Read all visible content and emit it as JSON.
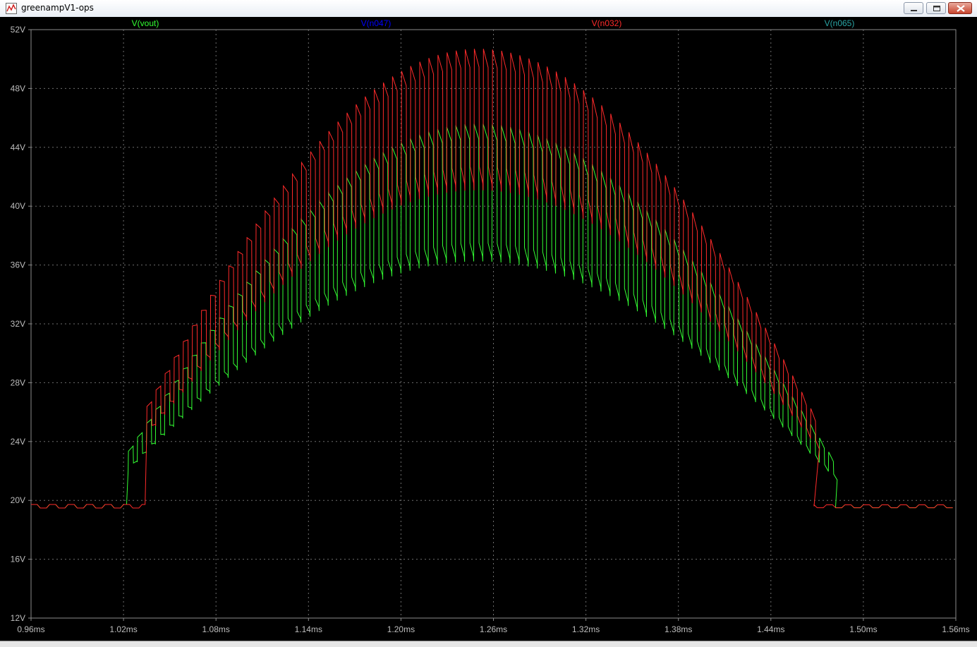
{
  "window": {
    "title": "greenampV1-ops"
  },
  "icons": {
    "app": "waveform-icon",
    "minimize": "minimize-icon",
    "maximize": "maximize-icon",
    "close": "close-icon"
  },
  "chart_data": {
    "type": "line",
    "background": "#000000",
    "grid": true,
    "x_unit": "ms",
    "y_unit": "V",
    "xlim": [
      0.96,
      1.56
    ],
    "ylim": [
      12,
      52
    ],
    "x_ticks": [
      0.96,
      1.02,
      1.08,
      1.14,
      1.2,
      1.26,
      1.32,
      1.38,
      1.44,
      1.5,
      1.56
    ],
    "x_tick_labels": [
      "0.96ms",
      "1.02ms",
      "1.08ms",
      "1.14ms",
      "1.20ms",
      "1.26ms",
      "1.32ms",
      "1.38ms",
      "1.44ms",
      "1.50ms",
      "1.56ms"
    ],
    "y_ticks": [
      12,
      16,
      20,
      24,
      28,
      32,
      36,
      40,
      44,
      48,
      52
    ],
    "y_tick_labels": [
      "12V",
      "16V",
      "20V",
      "24V",
      "28V",
      "32V",
      "36V",
      "40V",
      "44V",
      "48V",
      "52V"
    ],
    "legend": [
      "V(vout)",
      "V(n047)",
      "V(n032)",
      "V(n065)"
    ],
    "legend_placement": "top",
    "envelope": {
      "center_ms": 1.25,
      "half_period_ms": 0.5,
      "pulse_period_ms": 0.0059
    },
    "series": [
      {
        "name": "V(vout)",
        "color": "#33ff33",
        "baseline_v": 19.6,
        "low_peak_v": 37.5,
        "high_peak_v": 45.6,
        "start_ms": 1.023,
        "end_ms": 1.482
      },
      {
        "name": "V(n047)",
        "color": "#0000ff"
      },
      {
        "name": "V(n032)",
        "color": "#ff2a2a",
        "baseline_v": 19.6,
        "low_peak_v": 42.7,
        "high_peak_v": 50.7,
        "start_ms": 1.035,
        "end_ms": 1.468
      },
      {
        "name": "V(n065)",
        "color": "#2aa5a5"
      }
    ]
  }
}
